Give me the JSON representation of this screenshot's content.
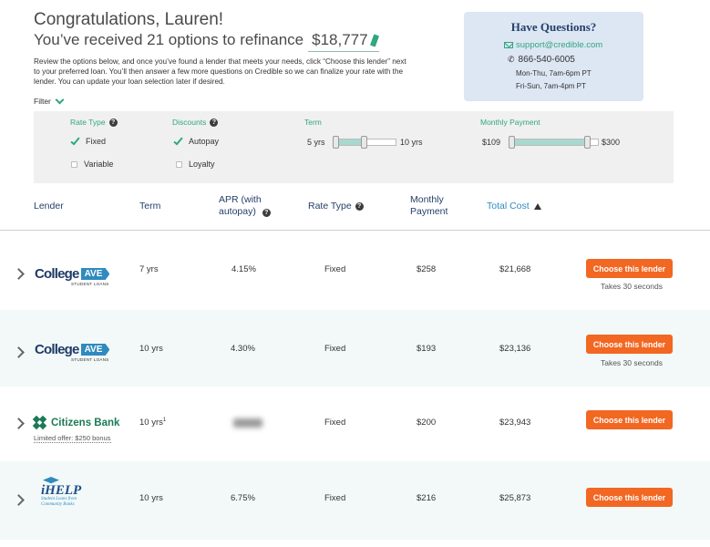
{
  "header": {
    "greeting": "Congratulations, Lauren!",
    "options_text": "You’ve received 21 options to refinance",
    "amount": "$18,777",
    "description": "Review the options below, and once you’ve found a lender that meets your needs, click “Choose this lender” next to your preferred loan. You’ll then answer a few more questions on Credible so we can finalize your rate with the lender. You can update your loan selection later if desired."
  },
  "filter_toggle": "Filter",
  "questions": {
    "title": "Have Questions?",
    "email": "support@credible.com",
    "phone": "866-540-6005",
    "hours_weekday": "Mon-Thu, 7am-6pm PT",
    "hours_weekend": "Fri-Sun, 7am-4pm PT"
  },
  "filters": {
    "rate_type": {
      "label": "Rate Type",
      "options": [
        {
          "label": "Fixed",
          "checked": true
        },
        {
          "label": "Variable",
          "checked": false
        }
      ]
    },
    "discounts": {
      "label": "Discounts",
      "options": [
        {
          "label": "Autopay",
          "checked": true
        },
        {
          "label": "Loyalty",
          "checked": false
        }
      ]
    },
    "term": {
      "label": "Term",
      "min_label": "5 yrs",
      "max_label": "10 yrs"
    },
    "monthly_payment": {
      "label": "Monthly Payment",
      "min_label": "$109",
      "max_label": "$300"
    }
  },
  "columns": {
    "lender": "Lender",
    "term": "Term",
    "apr": "APR (with autopay)",
    "rate_type": "Rate Type",
    "monthly_payment": "Monthly Payment",
    "total_cost": "Total Cost"
  },
  "rows": [
    {
      "lender": "College Ave",
      "term": "7 yrs",
      "apr": "4.15%",
      "rate_type": "Fixed",
      "monthly": "$258",
      "total": "$21,668",
      "button": "Choose this lender",
      "note": "Takes 30 seconds"
    },
    {
      "lender": "College Ave",
      "term": "10 yrs",
      "apr": "4.30%",
      "rate_type": "Fixed",
      "monthly": "$193",
      "total": "$23,136",
      "button": "Choose this lender",
      "note": "Takes 30 seconds"
    },
    {
      "lender": "Citizens Bank",
      "term": "10 yrs",
      "term_footnote": "1",
      "apr": "",
      "rate_type": "Fixed",
      "monthly": "$200",
      "total": "$23,943",
      "button": "Choose this lender",
      "promo": "Limited offer: $250 bonus"
    },
    {
      "lender": "iHELP",
      "term": "10 yrs",
      "apr": "6.75%",
      "rate_type": "Fixed",
      "monthly": "$216",
      "total": "$25,873",
      "button": "Choose this lender"
    }
  ],
  "logos": {
    "college_ave_word": "College",
    "college_ave_tag": "AVE",
    "college_ave_sub": "STUDENT LOANS",
    "citizens_word": "Citizens Bank",
    "ihelp_word": "iHELP",
    "ihelp_sub": "Student Loans from Community Banks"
  },
  "colors": {
    "accent_green": "#2fa77f",
    "navy": "#24406b",
    "button_orange": "#f26722",
    "row_alt": "#f2f9f8",
    "questions_bg": "#dde6f3"
  }
}
